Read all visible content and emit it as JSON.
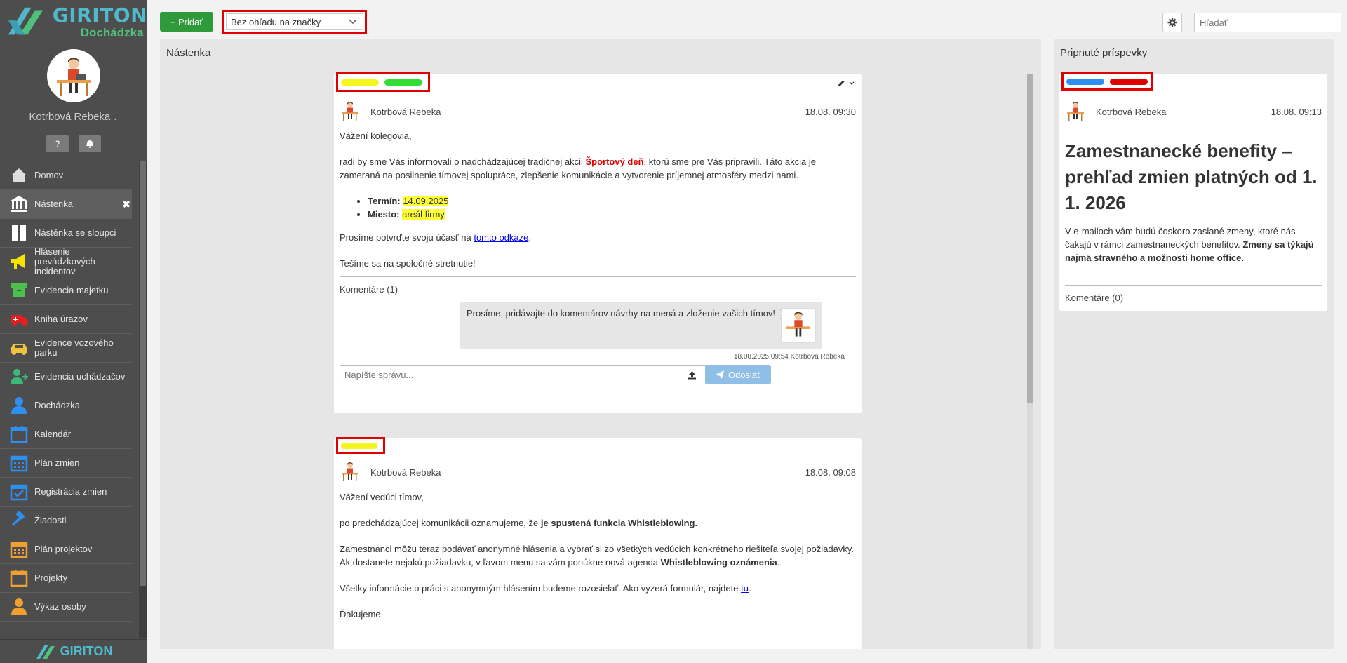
{
  "app": {
    "logo_name": "GIRITON",
    "logo_sub": "Dochádzka",
    "footer_logo": "GIRITON",
    "user_name": "Kotrbová Rebeka",
    "help_icon": "?",
    "bell_icon": "bell"
  },
  "menu": [
    {
      "label": "Domov",
      "icon": "home-icon",
      "color": "#dddddd"
    },
    {
      "label": "Nástenka",
      "icon": "bank-icon",
      "color": "#ffffff",
      "active": true
    },
    {
      "label": "Nástěnka se sloupci",
      "icon": "columns-icon",
      "color": "#ffffff"
    },
    {
      "label": "Hlásenie prevádzkových incidentov",
      "icon": "megaphone-icon",
      "color": "#f5e400"
    },
    {
      "label": "Evidencia majetku",
      "icon": "box-icon",
      "color": "#4cc04c"
    },
    {
      "label": "Kniha úrazov",
      "icon": "ambulance-icon",
      "color": "#e02020"
    },
    {
      "label": "Evidence vozového parku",
      "icon": "car-icon",
      "color": "#f0c040"
    },
    {
      "label": "Evidencia uchádzačov",
      "icon": "add-user-icon",
      "color": "#3cb878"
    },
    {
      "label": "Dochádzka",
      "icon": "user-icon",
      "color": "#2e8ff0"
    },
    {
      "label": "Kalendár",
      "icon": "calendar-icon",
      "color": "#2e8ff0"
    },
    {
      "label": "Plán zmien",
      "icon": "calendar-grid-icon",
      "color": "#2e8ff0"
    },
    {
      "label": "Registrácia zmien",
      "icon": "calendar-check-icon",
      "color": "#2e8ff0"
    },
    {
      "label": "Žiadosti",
      "icon": "gavel-icon",
      "color": "#2e8ff0"
    },
    {
      "label": "Plán projektov",
      "icon": "calendar-grid-icon",
      "color": "#f0a030"
    },
    {
      "label": "Projekty",
      "icon": "calendar-icon",
      "color": "#f0a030"
    },
    {
      "label": "Výkaz osoby",
      "icon": "user-icon",
      "color": "#f0a030"
    }
  ],
  "topbar": {
    "add_label": "+ Pridať",
    "tag_filter_value": "Bez ohľadu na značky",
    "search_placeholder": "Hľadať"
  },
  "board": {
    "title": "Nástenka",
    "posts": [
      {
        "tags": [
          "#f5f520",
          "#33dd33"
        ],
        "author": "Kotrbová Rebeka",
        "date": "18.08. 09:30",
        "greeting": "Vážení kolegovia,",
        "p1_a": "radi by sme Vás informovali o nadchádzajúcej tradičnej akcii ",
        "p1_event": "Športový deň",
        "p1_b": ", ktorú sme pre Vás pripravili. Táto akcia je zameraná na posilnenie tímovej spolupráce, zlepšenie komunikácie a vytvorenie príjemnej atmosféry medzi nami.",
        "term_label": "Termín: ",
        "term_value": "14.09.2025",
        "place_label": "Miesto: ",
        "place_value": "areál firmy",
        "confirm_a": "Prosíme potvrďte svoju účasť na ",
        "confirm_link": "tomto odkaze",
        "confirm_b": ".",
        "closing": "Tešíme sa na spoločné stretnutie!",
        "comments_label": "Komentáre (1)",
        "comment_text": "Prosíme, pridávajte do komentárov návrhy na mená a zloženie vašich tímov! :)",
        "comment_meta": "18.08.2025 09:54 Kotrbová Rebeka",
        "message_placeholder": "Napíšte správu...",
        "send_label": "Odoslať"
      },
      {
        "tags": [
          "#f5f520"
        ],
        "author": "Kotrbová Rebeka",
        "date": "18.08. 09:08",
        "greeting": "Vážení vedúci tímov,",
        "p1_a": "po predchádzajúcej komunikácii oznamujeme, že ",
        "p1_bold": "je spustená funkcia Whistleblowing.",
        "p2_a": "Zamestnanci môžu teraz podávať anonymné hlásenia a vybrať si zo všetkých vedúcich konkrétneho riešiteľa svojej požiadavky. Ak dostanete nejakú požiadavku, v ľavom menu sa vám ponúkne nová agenda ",
        "p2_bold": "Whistleblowing oznámenia",
        "p2_b": ".",
        "p3_a": "Všetky informácie o práci s anonymným hlásením budeme rozosielať. Ako vyzerá formulár, najdete ",
        "p3_link": "tu",
        "p3_b": ".",
        "closing": "Ďakujeme."
      }
    ]
  },
  "pinned": {
    "title": "Pripnuté príspevky",
    "post": {
      "tags": [
        "#2e8ff0",
        "#e00000"
      ],
      "author": "Kotrbová Rebeka",
      "date": "18.08. 09:13",
      "headline": "Zamestnanecké benefity – prehľad zmien platných od 1. 1. 2026",
      "text_a": "V e-mailoch vám budú čoskoro zaslané zmeny, ktoré nás čakajú v rámci zamestnaneckých benefitov. ",
      "text_bold": "Zmeny sa týkajú najmä stravného a možnosti home office.",
      "comments_label": "Komentáre (0)"
    }
  }
}
